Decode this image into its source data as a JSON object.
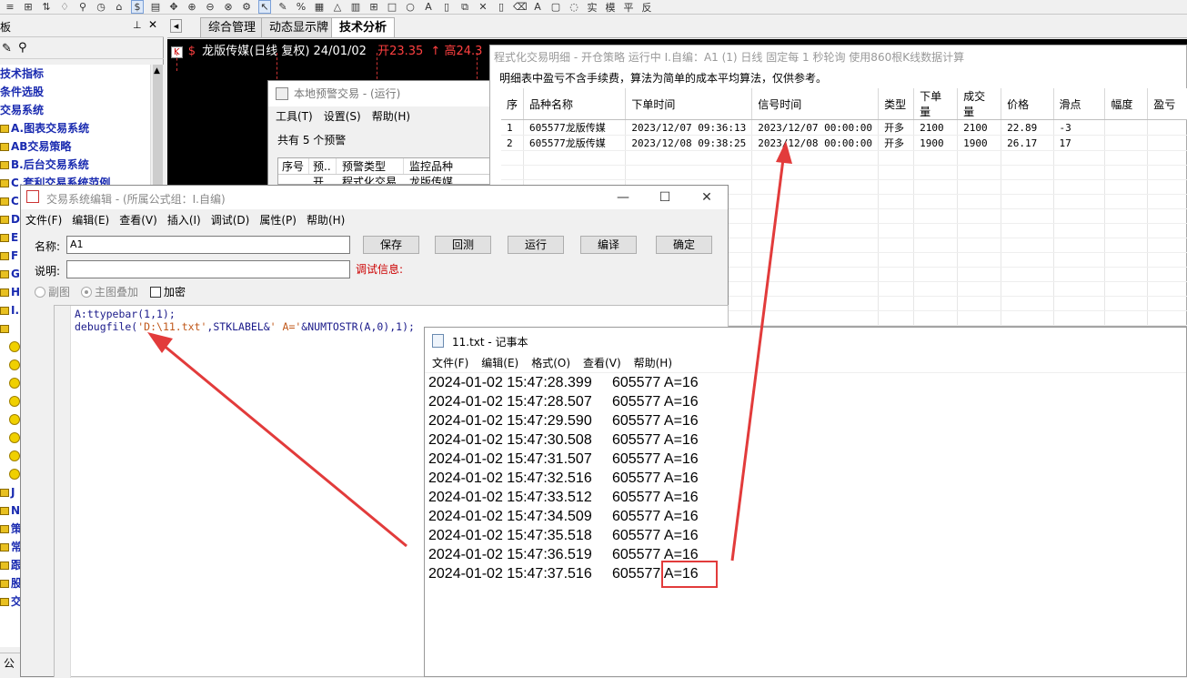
{
  "toolbar": {
    "icons": [
      "gear-icon",
      "cursor-icon",
      "pen-icon",
      "grid-icon"
    ]
  },
  "left_panel": {
    "title": "板",
    "bottom_label": "公",
    "tree": [
      {
        "label": "技术指标",
        "icon": false
      },
      {
        "label": "条件选股",
        "icon": false
      },
      {
        "label": "交易系统",
        "icon": false
      },
      {
        "label": "A.图表交易系统",
        "icon": true
      },
      {
        "label": "AB交易策略",
        "icon": true
      },
      {
        "label": "B.后台交易系统",
        "icon": true
      },
      {
        "label": "C.套利交易系统范例",
        "icon": true
      },
      {
        "label": "C",
        "icon": true
      },
      {
        "label": "D",
        "icon": true
      },
      {
        "label": "E",
        "icon": true
      },
      {
        "label": "F",
        "icon": true
      },
      {
        "label": "G",
        "icon": true
      },
      {
        "label": "H",
        "icon": true
      },
      {
        "label": "I.",
        "icon": true
      },
      {
        "label": "",
        "icon": true
      },
      {
        "label": "",
        "smile": true
      },
      {
        "label": "",
        "smile": true
      },
      {
        "label": "",
        "smile": true
      },
      {
        "label": "",
        "smile": true
      },
      {
        "label": "",
        "smile": true
      },
      {
        "label": "",
        "smile": true
      },
      {
        "label": "",
        "smile": true
      },
      {
        "label": "",
        "smile": true
      },
      {
        "label": "J",
        "icon": true
      },
      {
        "label": "N",
        "icon": true
      },
      {
        "label": "策",
        "icon": true
      },
      {
        "label": "常",
        "icon": true
      },
      {
        "label": "跟",
        "icon": true
      },
      {
        "label": "股",
        "icon": true
      },
      {
        "label": "交",
        "icon": true
      }
    ]
  },
  "tabs": [
    {
      "label": "综合管理",
      "active": false
    },
    {
      "label": "动态显示牌",
      "active": false
    },
    {
      "label": "技术分析",
      "active": true
    }
  ],
  "chart": {
    "badge": "K",
    "stock_name": "龙版传媒(日线 复权) 24/01/02",
    "open": "开23.35",
    "high": "高24.3"
  },
  "alert_window": {
    "title": "本地预警交易 - (运行)",
    "menu": [
      "工具(T)",
      "设置(S)",
      "帮助(H)"
    ],
    "count_text": "共有 5 个预警",
    "columns": [
      "序号",
      "预..",
      "预警类型",
      "监控品种"
    ],
    "partial_row": [
      "",
      "开",
      "程式化交易",
      "龙版传媒"
    ]
  },
  "detail_window": {
    "title": "程式化交易明细 - 开仓策略 运行中  I.自编：A1 (1) 日线 固定每 1 秒轮询 使用860根K线数据计算",
    "note": "明细表中盈亏不含手续费，算法为简单的成本平均算法，仅供参考。",
    "columns": [
      "序",
      "品种名称",
      "下单时间",
      "信号时间",
      "类型",
      "下单量",
      "成交量",
      "价格",
      "滑点",
      "幅度",
      "盈亏"
    ],
    "rows": [
      [
        "1",
        "605577龙版传媒",
        "2023/12/07 09:36:13",
        "2023/12/07 00:00:00",
        "开多",
        "2100",
        "2100",
        "22.89",
        "-3",
        "",
        ""
      ],
      [
        "2",
        "605577龙版传媒",
        "2023/12/08 09:38:25",
        "2023/12/08 00:00:00",
        "开多",
        "1900",
        "1900",
        "26.17",
        "17",
        "",
        ""
      ]
    ]
  },
  "editor": {
    "title": "交易系统编辑 - (所属公式组：I.自编)",
    "menu": [
      "文件(F)",
      "编辑(E)",
      "查看(V)",
      "插入(I)",
      "调试(D)",
      "属性(P)",
      "帮助(H)"
    ],
    "name_label": "名称:",
    "name_value": "A1",
    "desc_label": "说明:",
    "debug_label": "调试信息:",
    "buttons": [
      "保存",
      "回测",
      "运行",
      "编译",
      "确定"
    ],
    "radio_sub": "副图",
    "radio_main": "主图叠加",
    "encrypt": "加密",
    "code_line1": "A:ttypebar(1,1);",
    "code_line2_a": "debugfile(",
    "code_line2_b": "'D:\\11.txt'",
    "code_line2_c": ",STKLABEL&",
    "code_line2_d": "' A='",
    "code_line2_e": "&NUMTOSTR(A,0),1);"
  },
  "notepad": {
    "title": "11.txt - 记事本",
    "menu": [
      "文件(F)",
      "编辑(E)",
      "格式(O)",
      "查看(V)",
      "帮助(H)"
    ],
    "lines": [
      "2024-01-02 15:47:28.399     605577 A=16",
      "2024-01-02 15:47:28.507     605577 A=16",
      "2024-01-02 15:47:29.590     605577 A=16",
      "2024-01-02 15:47:30.508     605577 A=16",
      "2024-01-02 15:47:31.507     605577 A=16",
      "2024-01-02 15:47:32.516     605577 A=16",
      "2024-01-02 15:47:33.512     605577 A=16",
      "2024-01-02 15:47:34.509     605577 A=16",
      "2024-01-02 15:47:35.518     605577 A=16",
      "2024-01-02 15:47:36.519     605577 A=16",
      "2024-01-02 15:47:37.516     605577 A=16"
    ]
  },
  "colors": {
    "annotation": "#e23b3b",
    "chart_bg": "#000000",
    "tree_text": "#1a2bb0"
  }
}
